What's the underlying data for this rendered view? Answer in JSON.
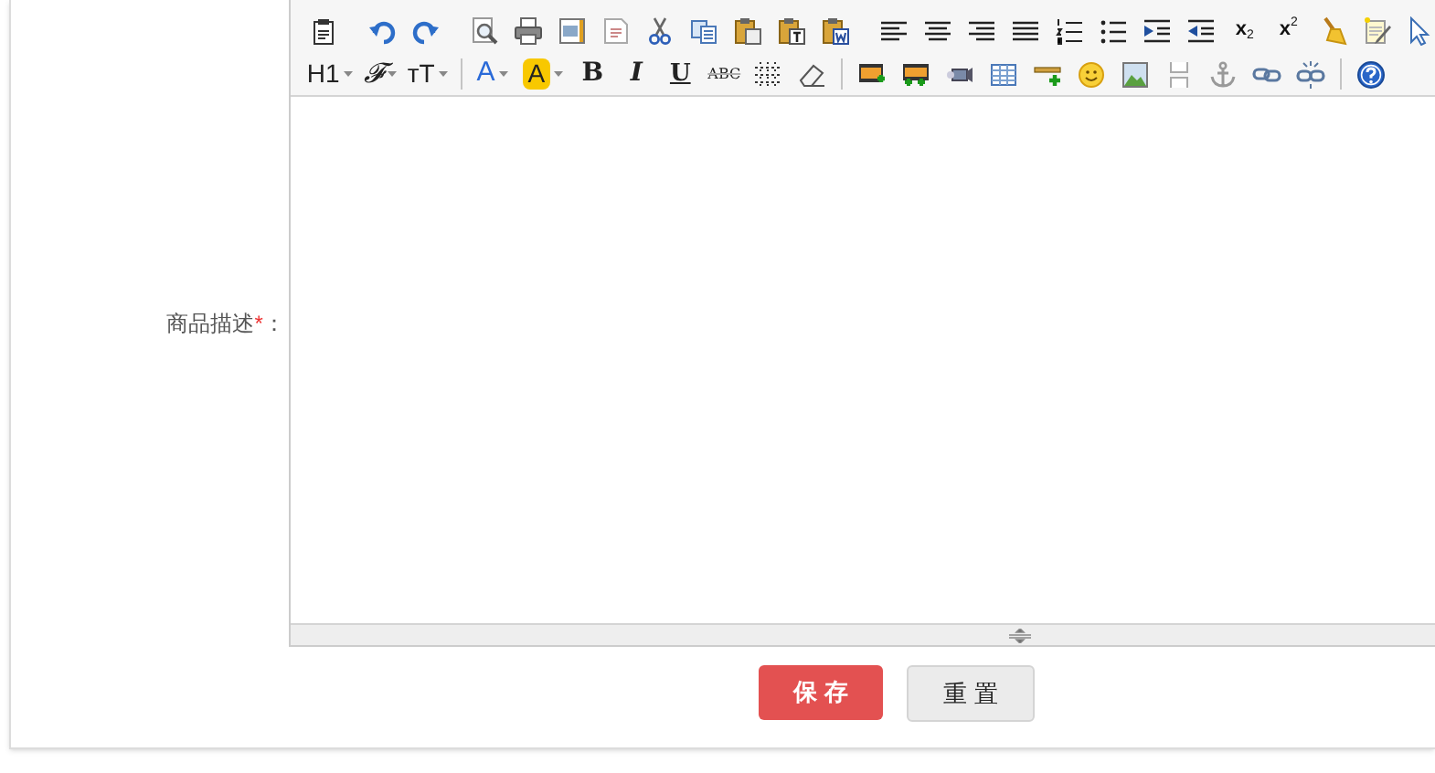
{
  "field": {
    "label": "商品描述",
    "required_mark": "*",
    "colon": "："
  },
  "editor": {
    "toolbar": [
      [
        {
          "kind": "icon"
        },
        {
          "kind": "separator"
        },
        {
          "kind": "icon"
        },
        {
          "kind": "icon"
        },
        {
          "kind": "separator"
        },
        {
          "kind": "icon"
        },
        {
          "kind": "icon"
        },
        {
          "kind": "icon"
        },
        {
          "kind": "icon"
        },
        {
          "kind": "icon"
        },
        {
          "kind": "icon"
        },
        {
          "kind": "icon"
        },
        {
          "kind": "icon"
        },
        {
          "kind": "icon"
        },
        {
          "kind": "separator"
        },
        {
          "kind": "icon"
        },
        {
          "kind": "icon"
        },
        {
          "kind": "icon"
        },
        {
          "kind": "icon"
        },
        {
          "kind": "icon"
        },
        {
          "kind": "icon"
        },
        {
          "kind": "icon"
        },
        {
          "kind": "icon"
        },
        {
          "kind": "sub",
          "label": "x",
          "script": "2"
        },
        {
          "kind": "sup",
          "label": "x",
          "script": "2"
        },
        {
          "kind": "icon"
        },
        {
          "kind": "icon"
        },
        {
          "kind": "icon"
        }
      ],
      [
        {
          "kind": "text",
          "label": "H1",
          "dropdown": true
        },
        {
          "kind": "script-text",
          "label": "𝓕",
          "dropdown": true
        },
        {
          "kind": "text",
          "label": "тT",
          "dropdown": true
        },
        {
          "kind": "separator"
        },
        {
          "kind": "color-text",
          "label": "A",
          "dropdown": true
        },
        {
          "kind": "highlight-text",
          "label": "A",
          "dropdown": true
        },
        {
          "kind": "bold",
          "label": "B"
        },
        {
          "kind": "italic",
          "label": "I"
        },
        {
          "kind": "underline",
          "label": "U"
        },
        {
          "kind": "strike",
          "label": "ABC"
        },
        {
          "kind": "icon"
        },
        {
          "kind": "icon"
        },
        {
          "kind": "separator"
        },
        {
          "kind": "icon"
        },
        {
          "kind": "icon"
        },
        {
          "kind": "icon"
        },
        {
          "kind": "icon"
        },
        {
          "kind": "icon"
        },
        {
          "kind": "icon"
        },
        {
          "kind": "icon"
        },
        {
          "kind": "icon"
        },
        {
          "kind": "icon"
        },
        {
          "kind": "icon"
        },
        {
          "kind": "icon"
        },
        {
          "kind": "separator"
        },
        {
          "kind": "icon"
        }
      ]
    ]
  },
  "buttons": [
    {
      "label": "保 存",
      "kind": "primary"
    },
    {
      "label": "重 置",
      "kind": "secondary"
    }
  ]
}
